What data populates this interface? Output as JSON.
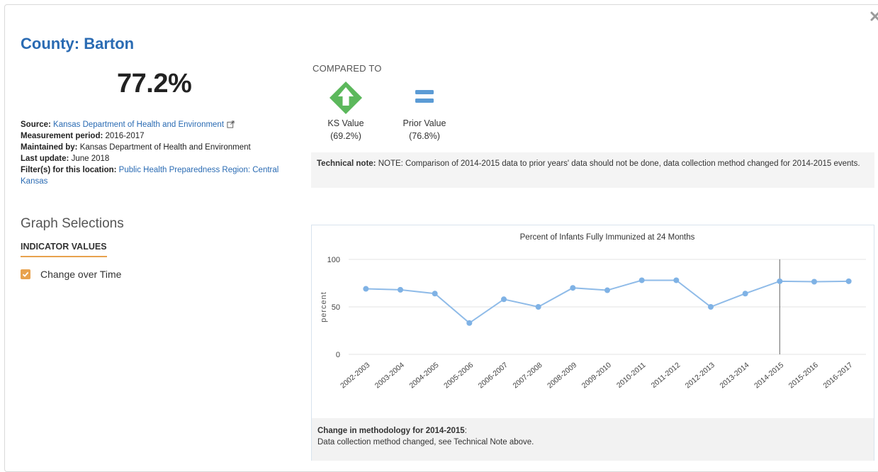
{
  "header": {
    "title": "County: Barton",
    "value": "77.2%"
  },
  "meta": {
    "source_label": "Source:",
    "source_value": "Kansas Department of Health and Environment",
    "period_label": "Measurement period:",
    "period_value": "2016-2017",
    "maintained_label": "Maintained by:",
    "maintained_value": "Kansas Department of Health and Environment",
    "update_label": "Last update:",
    "update_value": "June 2018",
    "filter_label": "Filter(s) for this location:",
    "filter_value": "Public Health Preparedness Region: Central Kansas"
  },
  "graph_selections": {
    "heading": "Graph Selections",
    "indicator_label": "INDICATOR VALUES",
    "option_label": "Change over Time",
    "option_checked": true
  },
  "comparison": {
    "heading": "COMPARED TO",
    "items": [
      {
        "label": "KS Value",
        "value": "(69.2%)",
        "icon": "green-up-arrow-icon"
      },
      {
        "label": "Prior Value",
        "value": "(76.8%)",
        "icon": "equal-icon"
      }
    ]
  },
  "technical_note": {
    "label": "Technical note:",
    "text": "NOTE: Comparison of 2014-2015 data to prior years' data should not be done, data collection method changed for 2014-2015 events."
  },
  "colors": {
    "accent_blue": "#2a6bb3",
    "orange": "#e8a24e",
    "green": "#5cb85c",
    "equal_blue": "#5b9bd5",
    "line": "#8fbbe8"
  },
  "chart_data": {
    "type": "line",
    "title": "Percent of Infants Fully Immunized at 24 Months",
    "ylabel": "percent",
    "xlabel": "",
    "ylim": [
      0,
      100
    ],
    "yticks": [
      0,
      50,
      100
    ],
    "categories": [
      "2002-2003",
      "2003-2004",
      "2004-2005",
      "2005-2006",
      "2006-2007",
      "2007-2008",
      "2008-2009",
      "2009-2010",
      "2010-2011",
      "2011-2012",
      "2012-2013",
      "2013-2014",
      "2014-2015",
      "2015-2016",
      "2016-2017"
    ],
    "series": [
      {
        "values": [
          69,
          68,
          64,
          33,
          58,
          50,
          70,
          67.5,
          78,
          78,
          50,
          64,
          77,
          76.5,
          77
        ]
      }
    ],
    "vertical_marker": "2014-2015",
    "grid": true
  },
  "chart_footer": {
    "title": "Change in methodology for 2014-2015",
    "text": "Data collection method changed, see Technical Note above."
  }
}
